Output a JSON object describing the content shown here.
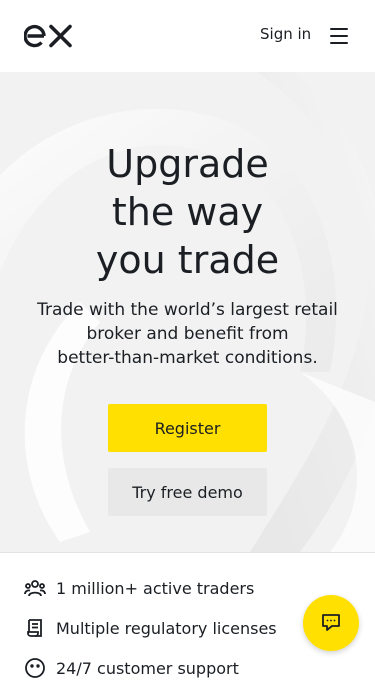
{
  "header": {
    "logo_text": "ex",
    "sign_in_label": "Sign in",
    "menu_icon": "hamburger-icon"
  },
  "hero": {
    "title_line1": "Upgrade",
    "title_line2": "the way",
    "title_line3": "you trade",
    "subtitle_line1": "Trade with the world’s largest retail",
    "subtitle_line2": "broker and benefit from",
    "subtitle_line3": "better-than-market conditions.",
    "register_label": "Register",
    "demo_label": "Try free demo"
  },
  "features": [
    {
      "icon": "users-icon",
      "label": "1 million+ active traders"
    },
    {
      "icon": "license-icon",
      "label": "Multiple regulatory licenses"
    },
    {
      "icon": "support-icon",
      "label": "24/7 customer support"
    }
  ],
  "chat": {
    "icon": "chat-icon"
  },
  "colors": {
    "accent": "#ffe000",
    "text": "#1b1f24",
    "hero_bg": "#f2f2f2",
    "secondary_button": "#e8e8e8"
  }
}
